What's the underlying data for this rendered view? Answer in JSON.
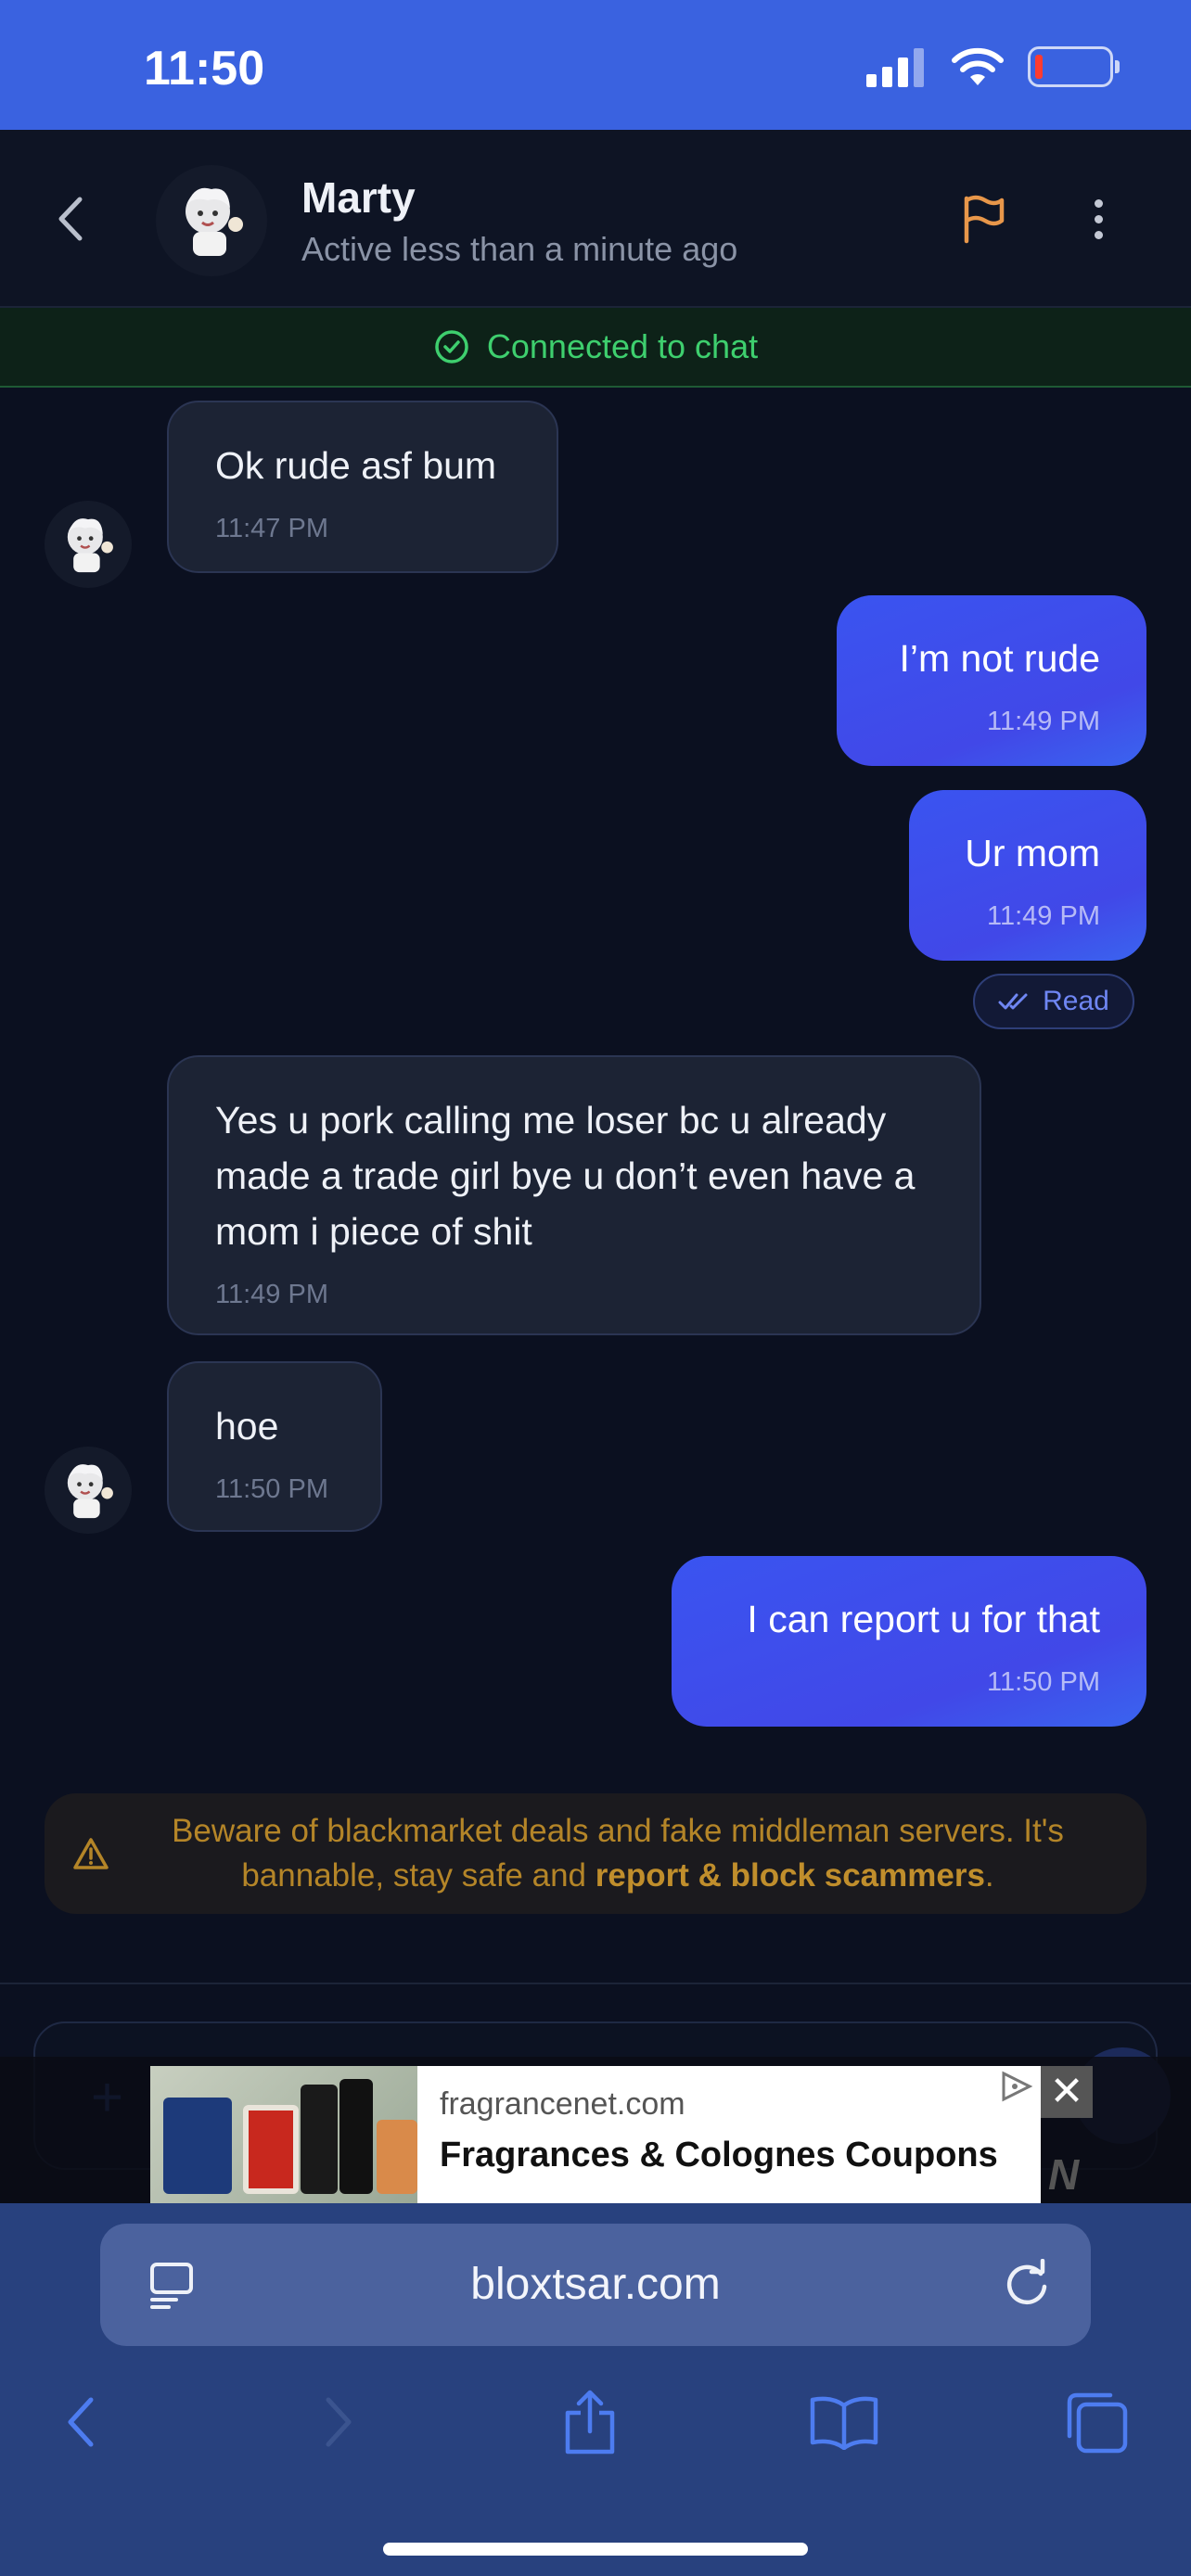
{
  "status_bar": {
    "time": "11:50"
  },
  "header": {
    "contact_name": "Marty",
    "contact_status": "Active less than a minute ago"
  },
  "banner": {
    "connected_text": "Connected to chat"
  },
  "messages": [
    {
      "direction": "incoming",
      "text": "Ok rude asf bum",
      "time": "11:47 PM"
    },
    {
      "direction": "outgoing",
      "text": "I’m not rude",
      "time": "11:49 PM"
    },
    {
      "direction": "outgoing",
      "text": "Ur mom",
      "time": "11:49 PM"
    },
    {
      "direction": "incoming",
      "text": "Yes u pork calling me loser bc u already made a trade girl bye u don’t even have a mom i piece of shit",
      "time": "11:49 PM"
    },
    {
      "direction": "incoming",
      "text": "hoe",
      "time": "11:50 PM"
    },
    {
      "direction": "outgoing",
      "text": "I can report u for that",
      "time": "11:50 PM"
    }
  ],
  "read_receipt": "Read",
  "warning": {
    "text": "Beware of blackmarket deals and fake middleman servers. It's bannable, stay safe and ",
    "bold": "report & block scammers",
    "suffix": "."
  },
  "ad": {
    "domain": "fragrancenet.com",
    "title": "Fragrances & Colognes Coupons",
    "close": "✕"
  },
  "browser": {
    "url": "bloxtsar.com"
  },
  "colors": {
    "status_bar": "#3a62e0",
    "outgoing_bubble": "#3a54f0",
    "incoming_bubble": "#1c2334",
    "connected_green": "#3ecf6e",
    "warning_gold": "#b48528",
    "browser_bar": "#28417e"
  }
}
